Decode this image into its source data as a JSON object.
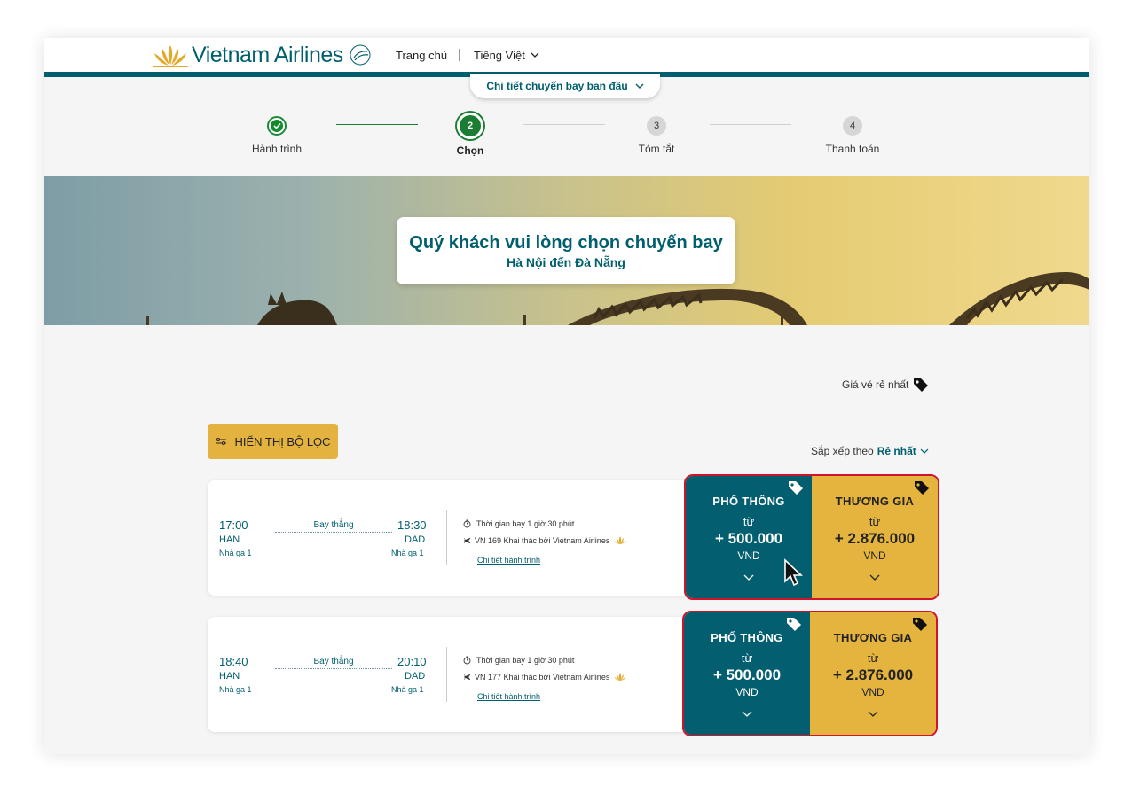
{
  "header": {
    "brand": "Vietnam Airlines",
    "nav_home": "Trang chủ",
    "nav_lang": "Tiếng Việt",
    "details_pill": "Chi tiết chuyến bay ban đầu"
  },
  "stepper": {
    "steps": [
      {
        "number": "1",
        "label": "Hành trình",
        "state": "done"
      },
      {
        "number": "2",
        "label": "Chọn",
        "state": "active"
      },
      {
        "number": "3",
        "label": "Tóm tắt",
        "state": "todo"
      },
      {
        "number": "4",
        "label": "Thanh toán",
        "state": "todo"
      }
    ]
  },
  "banner": {
    "title": "Quý khách vui lòng chọn chuyến bay",
    "subtitle": "Hà Nội đến Đà Nẵng"
  },
  "cheapest_label": "Giá vé rẻ nhất",
  "filter_button": "HIỂN THỊ BỘ LỌC",
  "sort": {
    "prefix": "Sắp xếp theo",
    "value": "Rẻ nhất"
  },
  "flights": [
    {
      "dep_time": "17:00",
      "arr_time": "18:30",
      "dep_airport": "HAN",
      "arr_airport": "DAD",
      "dep_terminal": "Nhà ga 1",
      "arr_terminal": "Nhà ga 1",
      "stop_type": "Bay thẳng",
      "duration": "Thời gian bay 1 giờ 30 phút",
      "operated": "VN 169 Khai thác bởi Vietnam Airlines",
      "details_link": "Chi tiết hành trình",
      "economy": {
        "name": "PHỔ THÔNG",
        "from": "từ",
        "price": "+ 500.000",
        "currency": "VND"
      },
      "business": {
        "name": "THƯƠNG GIA",
        "from": "từ",
        "price": "+ 2.876.000",
        "currency": "VND"
      }
    },
    {
      "dep_time": "18:40",
      "arr_time": "20:10",
      "dep_airport": "HAN",
      "arr_airport": "DAD",
      "dep_terminal": "Nhà ga 1",
      "arr_terminal": "Nhà ga 1",
      "stop_type": "Bay thẳng",
      "duration": "Thời gian bay 1 giờ 30 phút",
      "operated": "VN 177 Khai thác bởi Vietnam Airlines",
      "details_link": "Chi tiết hành trình",
      "economy": {
        "name": "PHỔ THÔNG",
        "from": "từ",
        "price": "+ 500.000",
        "currency": "VND"
      },
      "business": {
        "name": "THƯƠNG GIA",
        "from": "từ",
        "price": "+ 2.876.000",
        "currency": "VND"
      }
    }
  ],
  "colors": {
    "brand": "#005f6e",
    "gold": "#e4b43f",
    "highlight": "#d0152a",
    "success": "#1b7d34"
  }
}
